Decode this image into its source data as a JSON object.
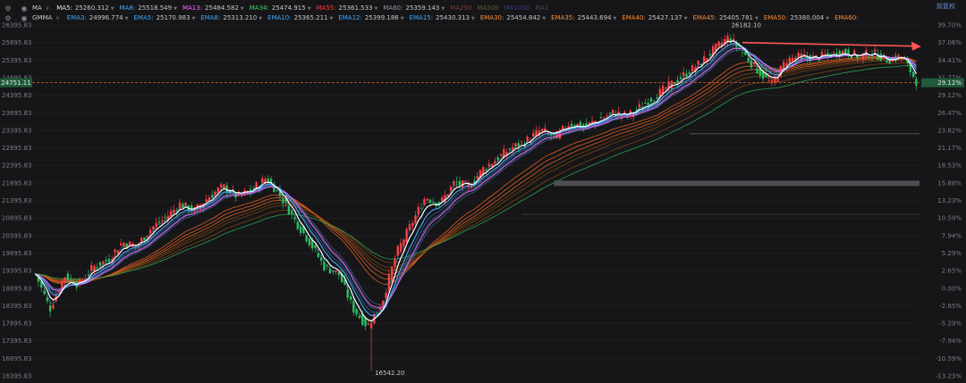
{
  "header": {
    "row1": {
      "group": "MA",
      "items": [
        {
          "label": "MA5:",
          "value": "25260.312",
          "color": "#e8e8ea"
        },
        {
          "label": "MA8:",
          "value": "25518.549",
          "color": "#4aa8ff"
        },
        {
          "label": "MA13:",
          "value": "25484.582",
          "color": "#ff66ff"
        },
        {
          "label": "MA34:",
          "value": "25474.915",
          "color": "#33dd66"
        },
        {
          "label": "MA55:",
          "value": "25361.533",
          "color": "#ff3b3b"
        },
        {
          "label": "MA60:",
          "value": "25359.143",
          "color": "#8a9aa8"
        },
        {
          "label": "MA250",
          "value": "",
          "color": "#7a3b3b"
        },
        {
          "label": "MA500",
          "value": "",
          "color": "#6b5a2a"
        },
        {
          "label": "MA1000",
          "value": "",
          "color": "#3b3b7a"
        },
        {
          "label": "MA1",
          "value": "",
          "color": "#4a4a50"
        }
      ]
    },
    "row2": {
      "group": "GMMA",
      "items": [
        {
          "label": "EMA3:",
          "value": "24996.774",
          "color": "#3fa8ff"
        },
        {
          "label": "EMA5:",
          "value": "25170.983",
          "color": "#3fa8ff"
        },
        {
          "label": "EMA8:",
          "value": "25313.210",
          "color": "#3fa8ff"
        },
        {
          "label": "EMA10:",
          "value": "25365.211",
          "color": "#3fa8ff"
        },
        {
          "label": "EMA12:",
          "value": "25399.186",
          "color": "#3fa8ff"
        },
        {
          "label": "EMA15:",
          "value": "25430.313",
          "color": "#3fa8ff"
        },
        {
          "label": "EMA30:",
          "value": "25454.842",
          "color": "#ff8a33"
        },
        {
          "label": "EMA35:",
          "value": "25443.694",
          "color": "#ff8a33"
        },
        {
          "label": "EMA40:",
          "value": "25427.137",
          "color": "#ff8a33"
        },
        {
          "label": "EMA45:",
          "value": "25405.781",
          "color": "#ff8a33"
        },
        {
          "label": "EMA50:",
          "value": "25380.004",
          "color": "#ff8a33"
        },
        {
          "label": "EMA60:",
          "value": "",
          "color": "#ff8a33"
        }
      ]
    },
    "adjust_label": "前复权"
  },
  "chart_data": {
    "type": "candlestick",
    "ylim": [
      16395.83,
      26395.83
    ],
    "base_price": 18653.23,
    "y_ticks": [
      "26395.83",
      "25895.83",
      "25395.83",
      "24895.83",
      "24395.83",
      "23895.83",
      "23395.83",
      "22895.83",
      "22395.83",
      "21895.83",
      "21395.83",
      "20895.83",
      "20395.83",
      "19895.83",
      "19395.83",
      "18895.83",
      "18395.83",
      "17895.83",
      "17395.83",
      "16895.83",
      "16395.83"
    ],
    "pct_ticks": [
      "39.70%",
      "37.06%",
      "34.41%",
      "31.77%",
      "29.12%",
      "26.47%",
      "23.82%",
      "21.17%",
      "18.53%",
      "15.88%",
      "13.23%",
      "10.59%",
      "7.94%",
      "5.29%",
      "2.65%",
      "0.00%",
      "-2.65%",
      "-5.29%",
      "-7.94%",
      "-10.59%",
      "-13.23%"
    ],
    "current_price": "24751.11",
    "current_pct": "29.12%",
    "high_label": "26182.10",
    "low_label": "16542.20",
    "key_closes": [
      19300,
      18300,
      19250,
      19000,
      19500,
      19700,
      20200,
      20100,
      20600,
      20900,
      21300,
      21100,
      21500,
      21800,
      21500,
      21700,
      22050,
      21500,
      20800,
      20200,
      19500,
      19300,
      18300,
      17800,
      18500,
      19900,
      20700,
      21500,
      21300,
      21900,
      21800,
      22300,
      22600,
      22900,
      23100,
      23400,
      23200,
      23600,
      23500,
      23700,
      23900,
      23800,
      24100,
      24400,
      24700,
      25000,
      25300,
      25700,
      26050,
      25600,
      25100,
      24700,
      25400,
      25500,
      25450,
      25550,
      25650,
      25500,
      25600,
      25400,
      25500,
      24800
    ],
    "colors": {
      "up": "#ff4040",
      "down": "#2fbf5f",
      "ma5": "#ffffff",
      "ma8": "#4aa8ff",
      "ma13": "#ff66ff",
      "ema_short": "#4aa8ff",
      "ema_long_start": "#ff6b22",
      "ema_long_end": "#8a4a10",
      "arrow": "#ff5555"
    }
  }
}
